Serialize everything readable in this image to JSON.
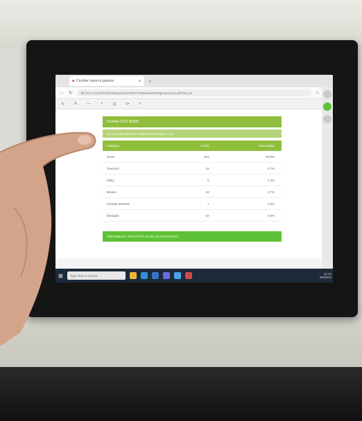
{
  "browser": {
    "tab_title": "Crusher report  a pasture",
    "url": "file:///C:/Users/fecs/Desktop/report?OZ7%20Data%20Wagmanreport.pdf?key=tk"
  },
  "report": {
    "header": "Crusher 5372 NOM6",
    "subheader": "Screen Classification / Material Distribution : 1.6",
    "columns": [
      "Category",
      "Count",
      "Percentage"
    ],
    "rows": [
      {
        "category": "Good",
        "count": "321",
        "percentage": "84.8%"
      },
      {
        "category": "Oversize",
        "count": "18",
        "percentage": "4.7%"
      },
      {
        "category": "Flaky",
        "count": "5",
        "percentage": "1.3%"
      },
      {
        "category": "Broken",
        "count": "18",
        "percentage": "4.7%"
      },
      {
        "category": "Foreign Material",
        "count": "7",
        "percentage": "1.8%"
      },
      {
        "category": "Elongate",
        "count": "10",
        "percentage": "2.6%"
      }
    ],
    "footer": "Total Material : 379 Ctrl Fin: 84.8% (Good/All Batch)"
  },
  "taskbar": {
    "search_placeholder": "Type here to search",
    "time": "11:14",
    "date": "4/5/2023"
  },
  "colors": {
    "accent_green": "#8fbe3c",
    "light_green": "#b5d47a",
    "bright_green": "#5ec236"
  }
}
